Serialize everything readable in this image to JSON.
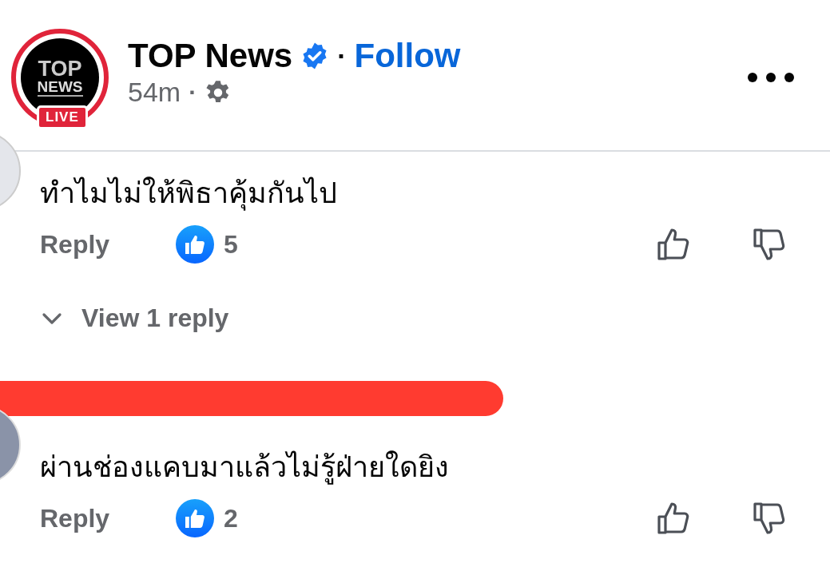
{
  "post_header": {
    "page_name": "TOP News",
    "verified": true,
    "separator": "·",
    "follow": "Follow",
    "time": "54m",
    "time_separator": "·",
    "avatar": {
      "logo_top": "TOP",
      "logo_bottom": "NEWS",
      "badge": "LIVE"
    }
  },
  "comments": [
    {
      "text": "ทำไมไม่ให้พิธาคุ้มกันไป",
      "reply": "Reply",
      "like_count": "5",
      "name_redacted": false,
      "view_replies": "View 1 reply"
    },
    {
      "text": "ผ่านช่องแคบมาแล้วไม่รู้ฝ่ายใดยิง",
      "reply": "Reply",
      "like_count": "2",
      "name_redacted": true
    }
  ]
}
